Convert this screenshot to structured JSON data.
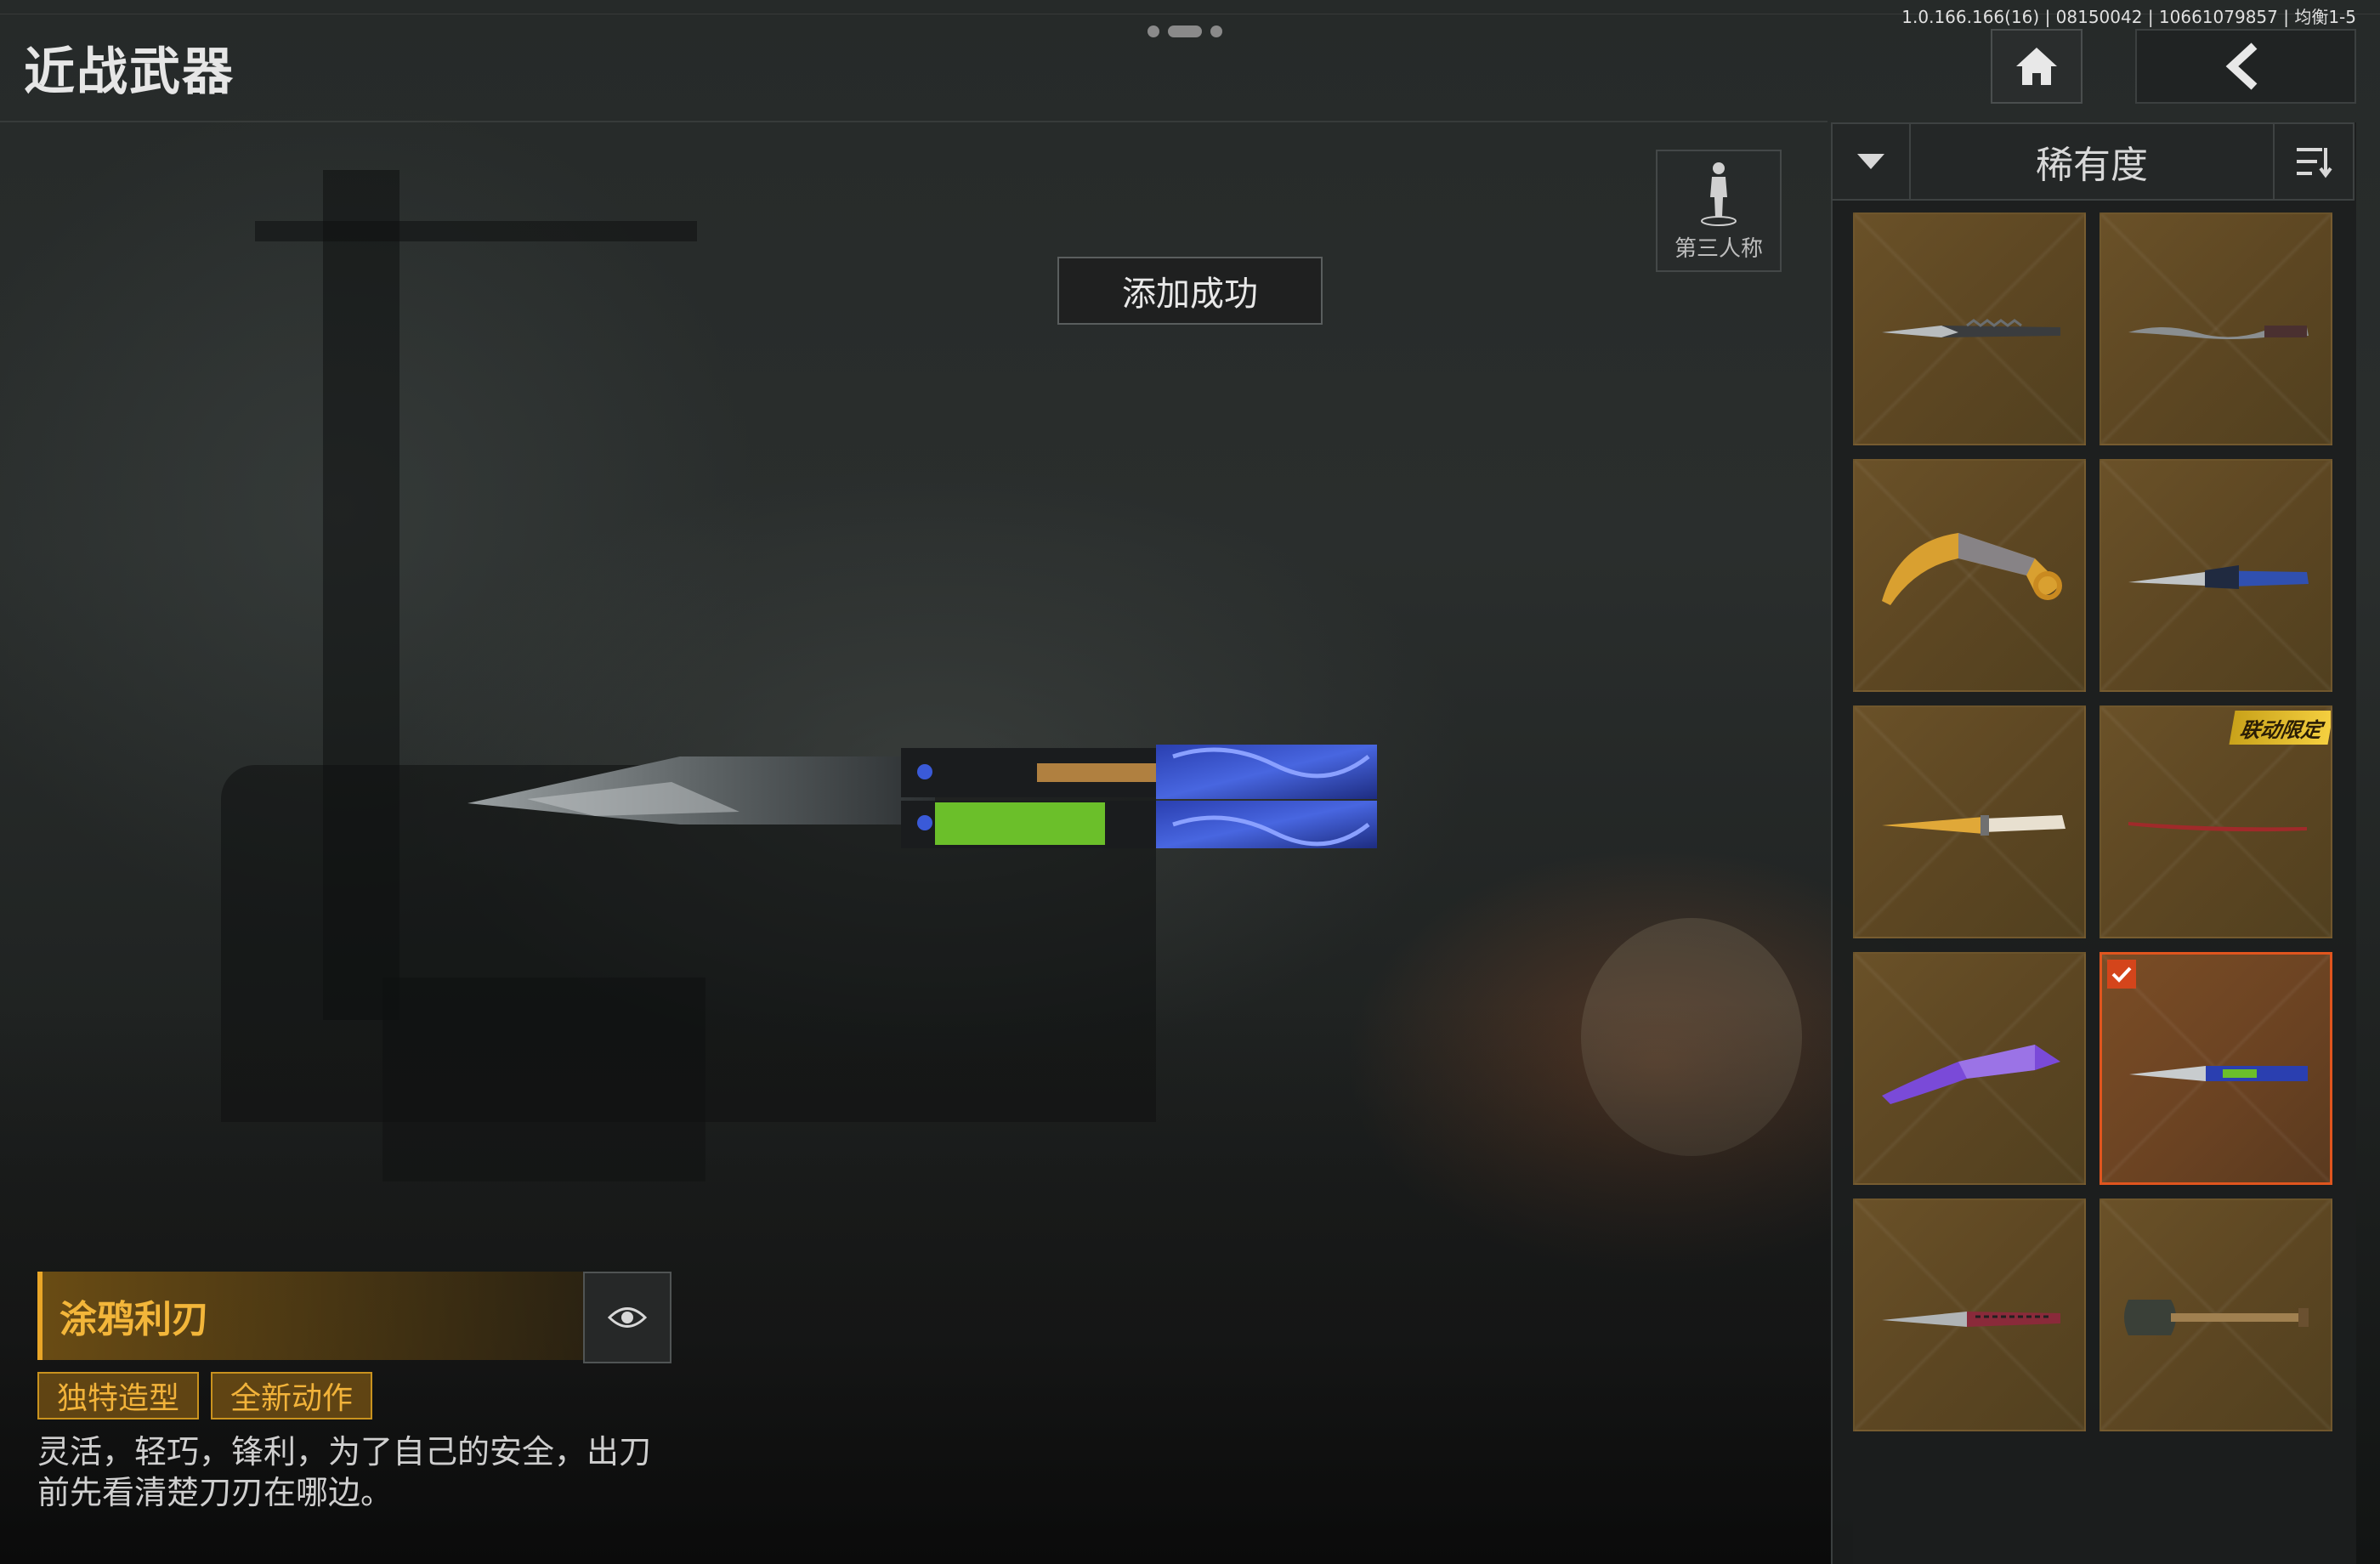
{
  "header": {
    "title": "近战武器",
    "status_text": "1.0.166.166(16) | 08150042 | 10661079857 | 均衡1-5"
  },
  "view": {
    "perspective_label": "第三人称"
  },
  "toast": {
    "message": "添加成功"
  },
  "weapon": {
    "name": "涂鸦利刃",
    "tags": [
      "独特造型",
      "全新动作"
    ],
    "description_lines": [
      "灵活，轻巧，锋利，为了自己的安全，出刀",
      "前先看清楚刀刃在哪边。"
    ]
  },
  "sort": {
    "label": "稀有度"
  },
  "grid": {
    "items": [
      {
        "icon": "serrated-dark-knife-icon",
        "selected": false,
        "badge": ""
      },
      {
        "icon": "wavy-dagger-icon",
        "selected": false,
        "badge": ""
      },
      {
        "icon": "golden-karambit-icon",
        "selected": false,
        "badge": ""
      },
      {
        "icon": "blue-combat-knife-icon",
        "selected": false,
        "badge": ""
      },
      {
        "icon": "gold-hunting-knife-icon",
        "selected": false,
        "badge": ""
      },
      {
        "icon": "red-katana-icon",
        "selected": false,
        "badge": "联动限定"
      },
      {
        "icon": "purple-karambit-icon",
        "selected": false,
        "badge": ""
      },
      {
        "icon": "graffiti-butterfly-knife-icon",
        "selected": true,
        "badge": ""
      },
      {
        "icon": "red-tactical-knife-icon",
        "selected": false,
        "badge": ""
      },
      {
        "icon": "shovel-icon",
        "selected": false,
        "badge": ""
      }
    ]
  },
  "colors": {
    "accent": "#f3b63a",
    "selected_border": "#e0551e",
    "card_bg": "#5c4622"
  }
}
